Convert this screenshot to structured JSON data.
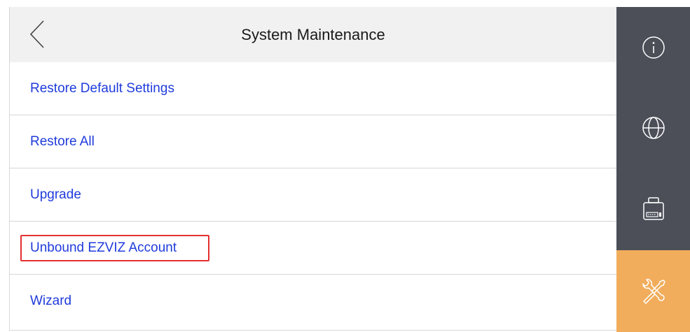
{
  "header": {
    "title": "System Maintenance"
  },
  "menu": {
    "items": [
      {
        "label": "Restore Default Settings"
      },
      {
        "label": "Restore All"
      },
      {
        "label": "Upgrade"
      },
      {
        "label": "Unbound EZVIZ Account",
        "highlighted": true
      },
      {
        "label": "Wizard"
      }
    ]
  },
  "sidebar": {
    "buttons": [
      {
        "icon": "info-icon",
        "active": false
      },
      {
        "icon": "globe-icon",
        "active": false
      },
      {
        "icon": "device-config-icon",
        "active": false
      },
      {
        "icon": "maintenance-tools-icon",
        "active": true
      }
    ]
  },
  "colors": {
    "link": "#1f3bdc",
    "sidebar_bg": "#4c4e58",
    "sidebar_active": "#f1ad5c",
    "header_bg": "#f1f1f1",
    "highlight_border": "#e53030"
  }
}
